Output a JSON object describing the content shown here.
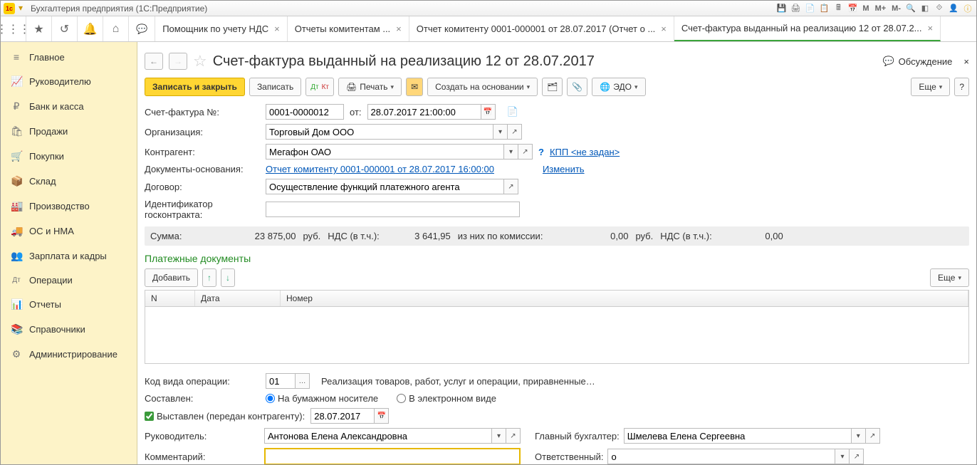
{
  "titlebar": {
    "app_title": "Бухгалтерия предприятия  (1С:Предприятие)",
    "m_buttons": [
      "M",
      "M+",
      "M-"
    ]
  },
  "tabs": [
    {
      "label": "Помощник по учету НДС",
      "active": false
    },
    {
      "label": "Отчеты комитентам ...",
      "active": false
    },
    {
      "label": "Отчет комитенту 0001-000001 от 28.07.2017 (Отчет о ...",
      "active": false
    },
    {
      "label": "Счет-фактура выданный на реализацию 12 от 28.07.2...",
      "active": true
    }
  ],
  "sidebar": [
    {
      "icon": "≡",
      "label": "Главное"
    },
    {
      "icon": "📈",
      "label": "Руководителю"
    },
    {
      "icon": "₽",
      "label": "Банк и касса"
    },
    {
      "icon": "🛍",
      "label": "Продажи"
    },
    {
      "icon": "🛒",
      "label": "Покупки"
    },
    {
      "icon": "📦",
      "label": "Склад"
    },
    {
      "icon": "🏭",
      "label": "Производство"
    },
    {
      "icon": "🚚",
      "label": "ОС и НМА"
    },
    {
      "icon": "👥",
      "label": "Зарплата и кадры"
    },
    {
      "icon": "Дт",
      "label": "Операции"
    },
    {
      "icon": "📊",
      "label": "Отчеты"
    },
    {
      "icon": "📚",
      "label": "Справочники"
    },
    {
      "icon": "⚙",
      "label": "Администрирование"
    }
  ],
  "doc": {
    "title": "Счет-фактура выданный на реализацию 12 от 28.07.2017",
    "discuss": "Обсуждение"
  },
  "cmd": {
    "save_close": "Записать и закрыть",
    "save": "Записать",
    "print": "Печать",
    "create_based": "Создать на основании",
    "edo": "ЭДО",
    "more": "Еще"
  },
  "fields": {
    "sf_no_label": "Счет-фактура №:",
    "sf_no": "0001-0000012",
    "ot": "от:",
    "date": "28.07.2017 21:00:00",
    "org_label": "Организация:",
    "org": "Торговый Дом ООО",
    "contr_label": "Контрагент:",
    "contr": "Мегафон ОАО",
    "kpp": "КПП <не задан>",
    "docs_label": "Документы-основания:",
    "docs_link": "Отчет комитенту 0001-000001 от 28.07.2017 16:00:00",
    "change": "Изменить",
    "contract_label": "Договор:",
    "contract": "Осуществление функций платежного агента",
    "gos_label": "Идентификатор госконтракта:"
  },
  "sums": {
    "sum_label": "Сумма:",
    "sum": "23 875,00",
    "rub": "руб.",
    "vat_incl": "НДС (в т.ч.):",
    "vat": "3 641,95",
    "comm_label": "из них по комиссии:",
    "comm": "0,00",
    "vat2": "0,00"
  },
  "payments": {
    "title": "Платежные документы",
    "add": "Добавить",
    "more": "Еще",
    "cols": {
      "n": "N",
      "date": "Дата",
      "num": "Номер"
    }
  },
  "footer": {
    "op_code_label": "Код вида операции:",
    "op_code": "01",
    "op_desc": "Реализация товаров, работ, услуг и операции, приравненные…",
    "sostav_label": "Составлен:",
    "r1": "На бумажном носителе",
    "r2": "В электронном виде",
    "issued": "Выставлен (передан контрагенту):",
    "issued_date": "28.07.2017",
    "manager_label": "Руководитель:",
    "manager": "Антонова Елена Александровна",
    "chief_acc_label": "Главный бухгалтер:",
    "chief_acc": "Шмелева Елена Сергеевна",
    "comment_label": "Комментарий:",
    "resp_label": "Ответственный:",
    "resp": "о"
  }
}
